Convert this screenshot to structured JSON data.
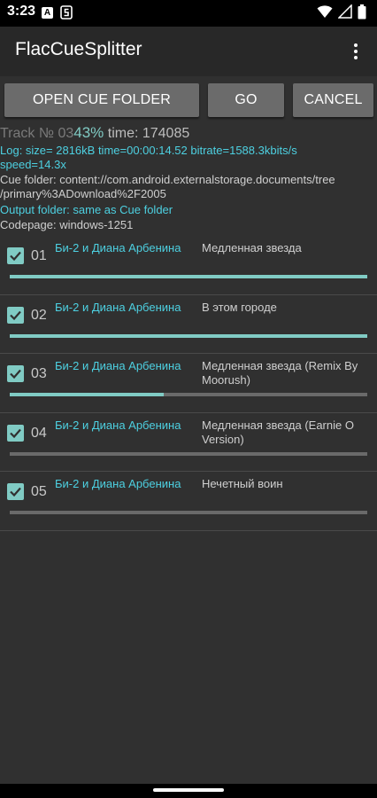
{
  "status_bar": {
    "time": "3:23",
    "notif_a": "A"
  },
  "app_bar": {
    "title": "FlacCueSplitter"
  },
  "buttons": {
    "open": "OPEN CUE FOLDER",
    "go": "GO",
    "cancel": "CANCEL"
  },
  "info": {
    "track_label": "Track № 03",
    "percent": "43%",
    "time": " time: 174085",
    "log_1": "Log: size=    2816kB time=00:00:14.52 bitrate=1588.3kbits/s",
    "log_2": "speed=14.3x",
    "cue_folder_1": "Cue folder: content://com.android.externalstorage.documents/tree",
    "cue_folder_2": "/primary%3ADownload%2F2005",
    "output_folder": "Output folder: same as Cue folder",
    "codepage": "Codepage: windows-1251"
  },
  "tracks": [
    {
      "num": "01",
      "artist": "Би-2 и Диана Арбенина",
      "title": "Медленная звезда",
      "progress": 1.0
    },
    {
      "num": "02",
      "artist": "Би-2 и Диана Арбенина",
      "title": "В этом городе",
      "progress": 1.0
    },
    {
      "num": "03",
      "artist": "Би-2 и Диана Арбенина",
      "title": "Медленная звезда (Remix By Moorush)",
      "progress": 0.43
    },
    {
      "num": "04",
      "artist": "Би-2 и Диана Арбенина",
      "title": "Медленная звезда (Earnie O Version)",
      "progress": 0.0
    },
    {
      "num": "05",
      "artist": "Би-2 и Диана Арбенина",
      "title": "Нечетный воин",
      "progress": 0.0
    }
  ],
  "colors": {
    "accent": "#80cbc4",
    "cyan": "#4dd0e1"
  }
}
